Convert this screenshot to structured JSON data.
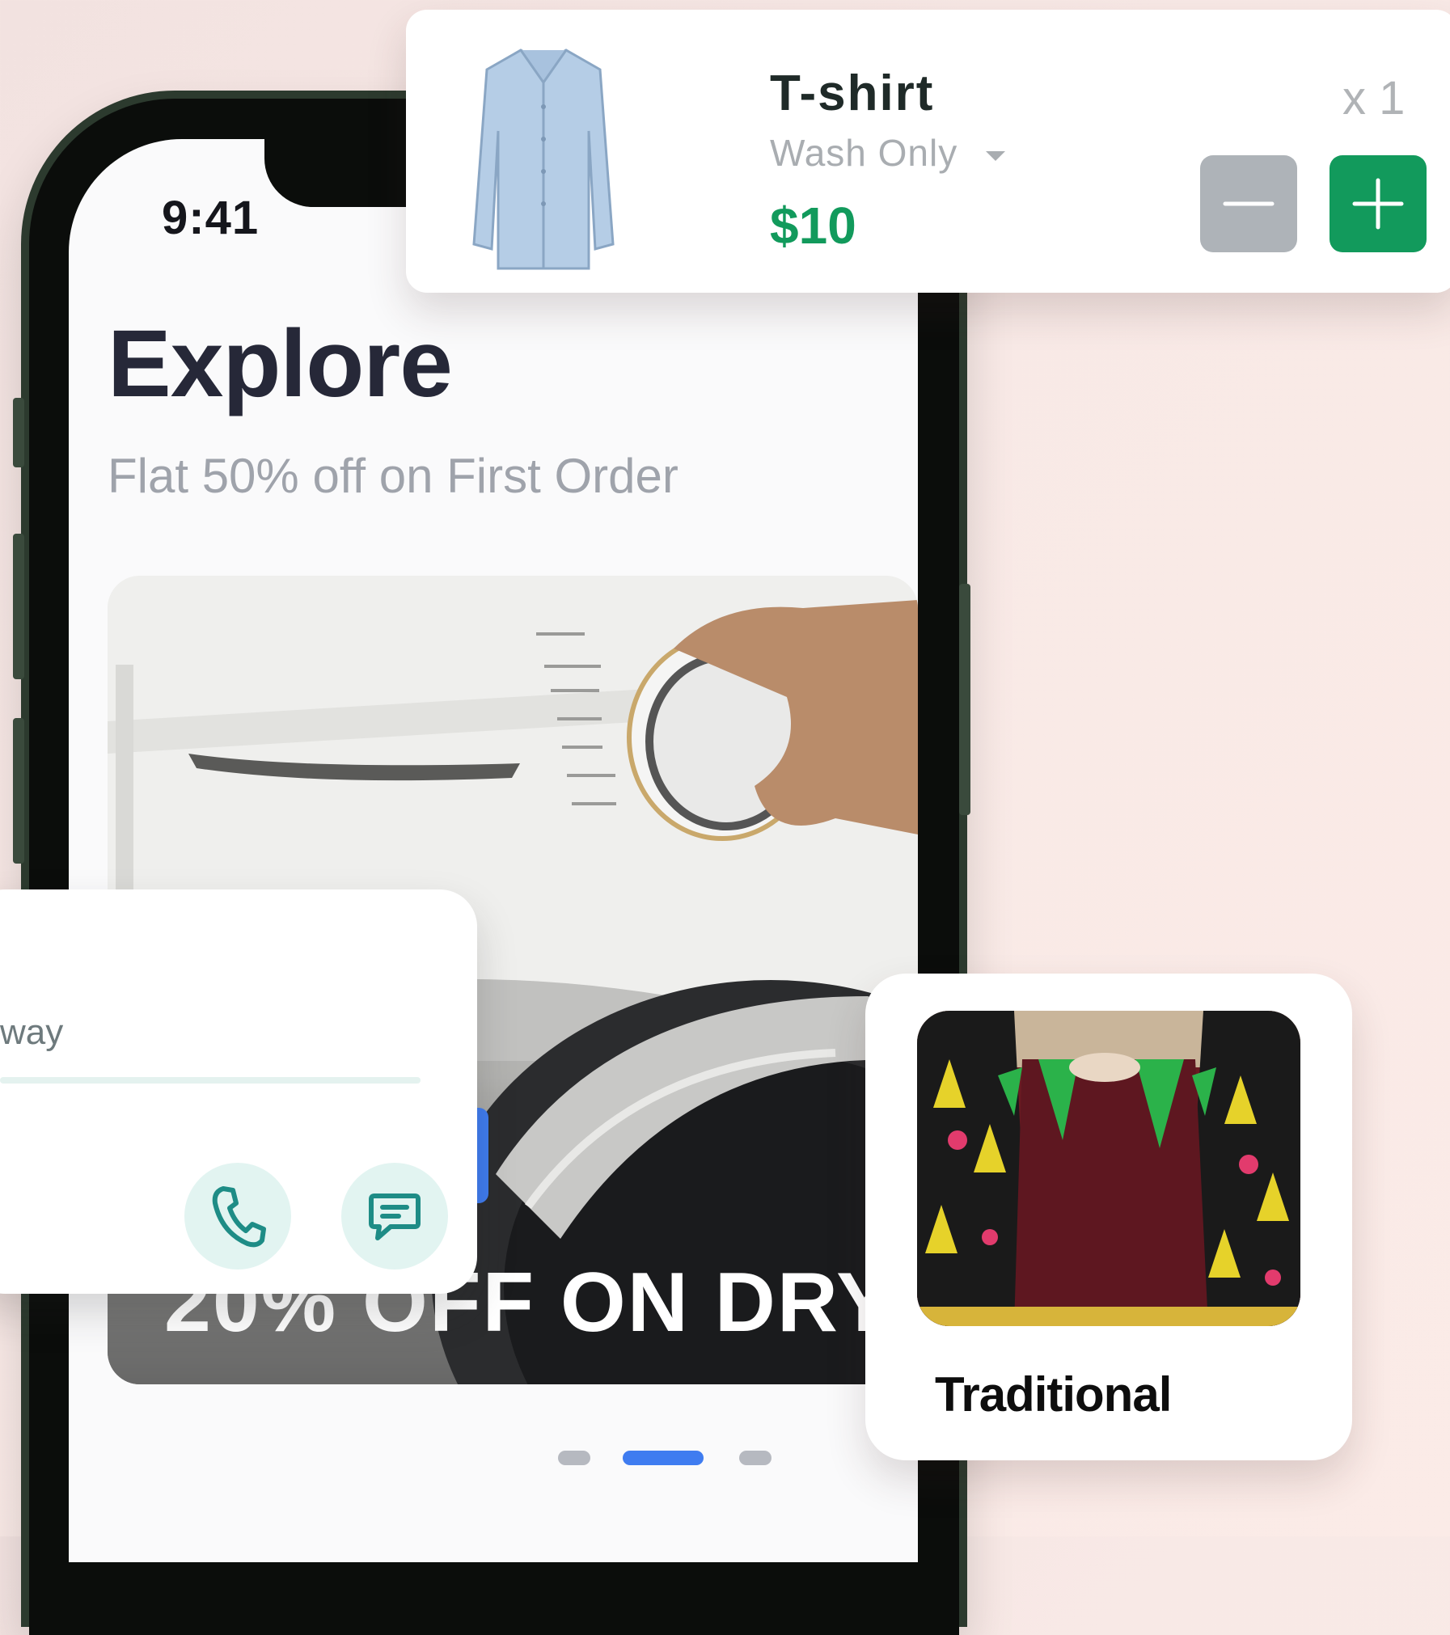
{
  "status_bar": {
    "time": "9:41"
  },
  "explore": {
    "title": "Explore",
    "promo": "Flat 50% off on First Order",
    "banner_text": "20% OFF ON DRY",
    "carousel_pages": 3,
    "carousel_active_index": 1
  },
  "item_card": {
    "name": "T-shirt",
    "service": "Wash Only",
    "price": "$10",
    "quantity": "x 1",
    "image_icon": "shirt-icon",
    "decrease_icon": "minus-icon",
    "increase_icon": "plus-icon"
  },
  "contact_card": {
    "partial_text": "way",
    "call_icon": "phone-icon",
    "message_icon": "chat-icon"
  },
  "category_card": {
    "label": "Traditional",
    "image_icon": "traditional-clothing-image"
  },
  "colors": {
    "accent_green": "#129a5c",
    "accent_blue": "#3f7cf0",
    "button_gray": "#aeb3b8",
    "background": "#f8e9e6"
  }
}
